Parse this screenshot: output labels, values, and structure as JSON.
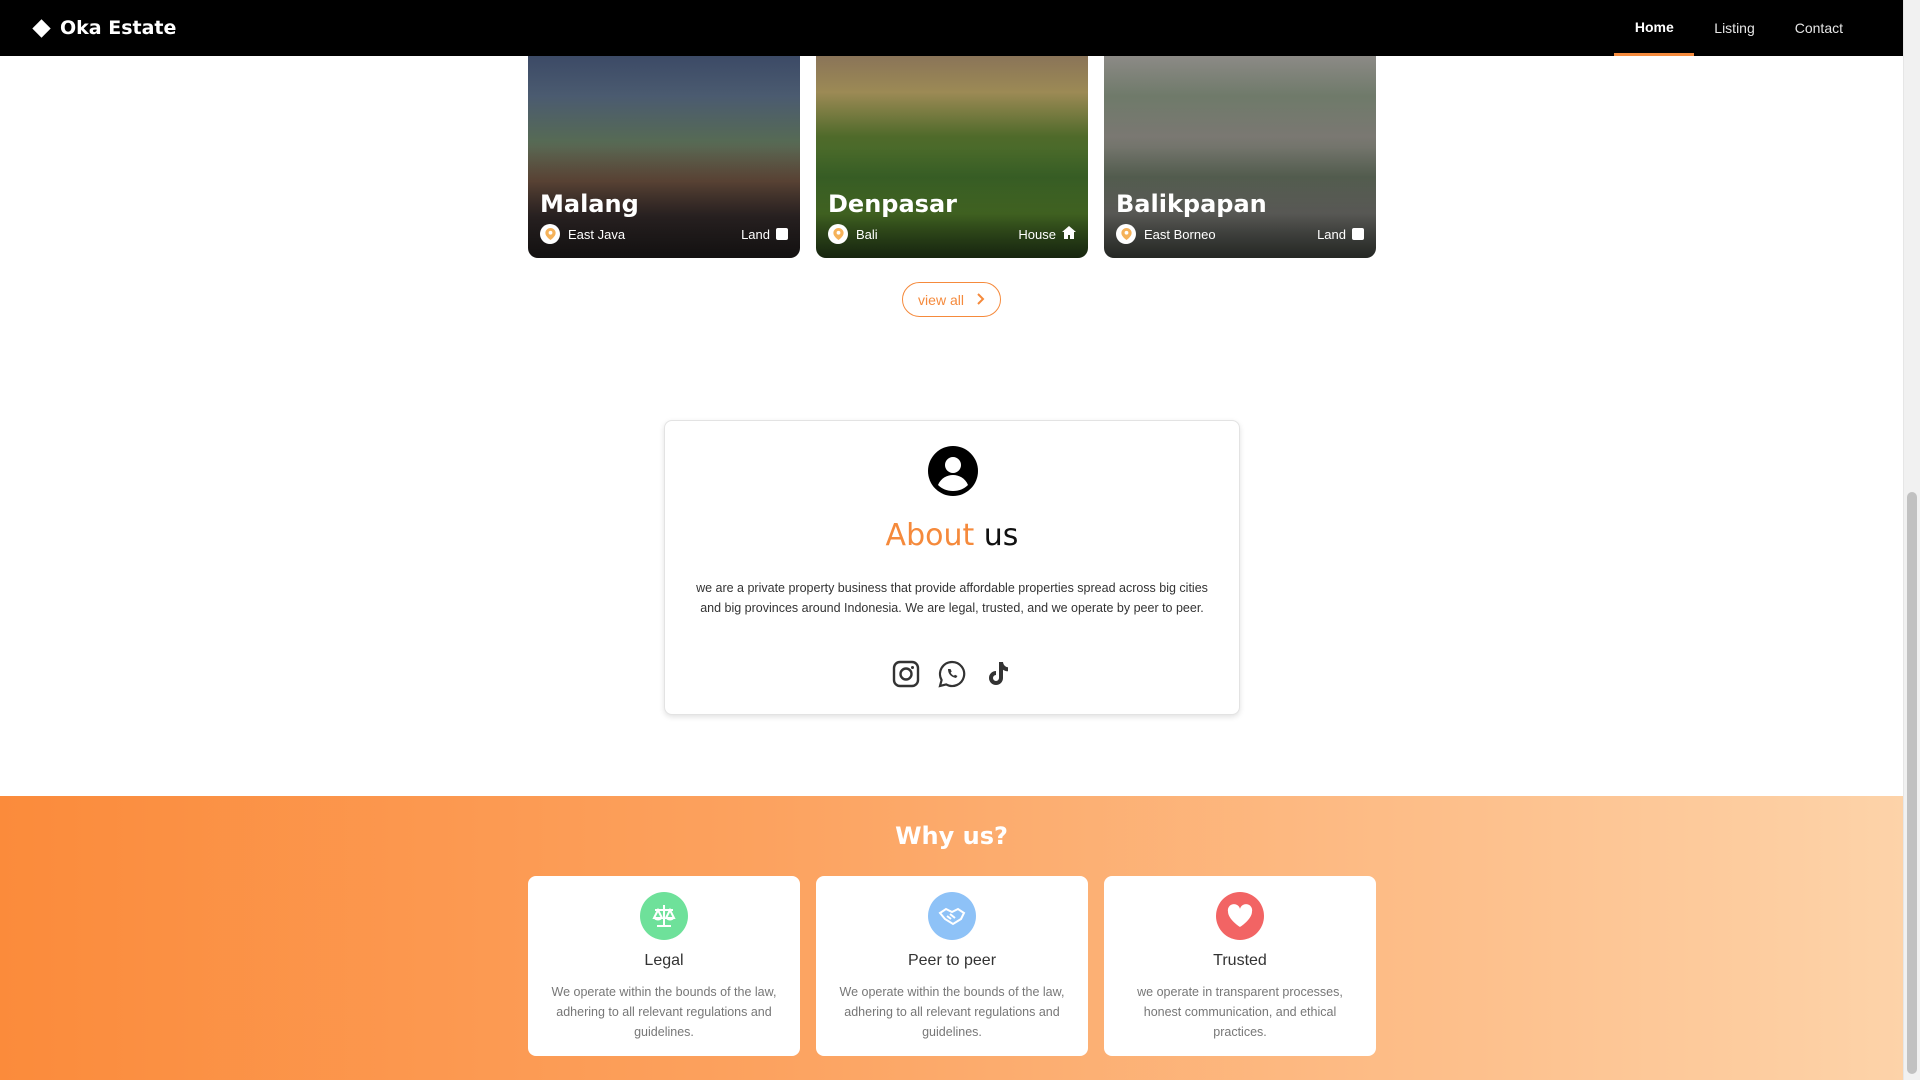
{
  "nav": {
    "brand": "Oka Estate",
    "links": [
      "Home",
      "Listing",
      "Contact"
    ],
    "active": "Home"
  },
  "properties": [
    {
      "city": "Malang",
      "region": "East Java",
      "type": "Land",
      "type_icon": "square-icon"
    },
    {
      "city": "Denpasar",
      "region": "Bali",
      "type": "House",
      "type_icon": "house-icon"
    },
    {
      "city": "Balikpapan",
      "region": "East Borneo",
      "type": "Land",
      "type_icon": "square-icon"
    }
  ],
  "view_all": {
    "label": "view all",
    "icon": "chevron-right-icon"
  },
  "about": {
    "title_accent": "About",
    "title_rest": "us",
    "text": "we are a private property business that provide affordable properties spread across big cities and big provinces around Indonesia. We are legal, trusted, and we operate by peer to peer.",
    "socials": [
      "instagram-icon",
      "whatsapp-icon",
      "tiktok-icon"
    ]
  },
  "why_us": {
    "title": "Why us?",
    "cards": [
      {
        "title": "Legal",
        "text": "We operate within the bounds of the law, adhering to all relevant regulations and guidelines.",
        "icon": "scale-icon",
        "color": "#6ee19a"
      },
      {
        "title": "Peer to peer",
        "text": "We operate within the bounds of the law, adhering to all relevant regulations and guidelines.",
        "icon": "handshake-icon",
        "color": "#8ec2f7"
      },
      {
        "title": "Trusted",
        "text": "we operate in transparent processes, honest communication, and ethical practices.",
        "icon": "heart-icon",
        "color": "#f26464"
      }
    ]
  },
  "colors": {
    "accent": "#f58a3c",
    "navbar": "#000000"
  }
}
